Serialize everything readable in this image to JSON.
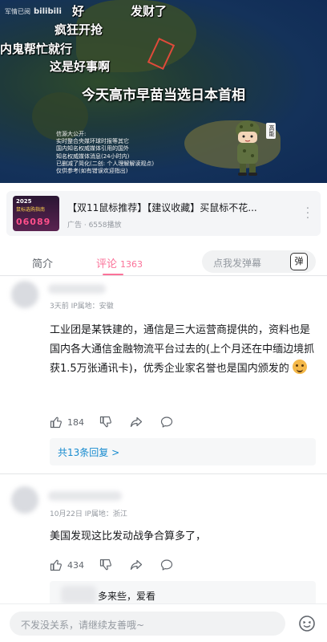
{
  "video": {
    "brand_left": "军情已阅",
    "brand_logo": "bilibili",
    "danmaku": [
      "好",
      "发财了",
      "疯狂开抢",
      "内鬼帮忙就行",
      "这是好事啊"
    ],
    "caption": "今天高市早苗当选日本首相",
    "source_lines": [
      "信源大公开:",
      "实时整合央媒环球时报等其它",
      "国内知名权威媒体引用的国外",
      "知名权威媒体消息(24小时内)",
      "已删减了简化(二创: 个人理解解读观点)",
      "仅供参考(如有错误欢迎指出)"
    ],
    "soldier_tag": "高能"
  },
  "ad": {
    "thumb_line1": "2025",
    "thumb_line2": "鼠标选购指南",
    "thumb_line3": "06089",
    "title": "【双11鼠标推荐】【建议收藏】买鼠标不花...",
    "meta": "广告 · 6558播放",
    "more_icon": "more-vertical-icon"
  },
  "tabs": {
    "intro": "简介",
    "comments": "评论",
    "comments_count": "1363",
    "danmaku_placeholder": "点我发弹幕",
    "danmaku_button": "弹"
  },
  "comments": [
    {
      "meta": "3天前 IP属地：安徽",
      "text": "工业团是某铁建的，通信是三大运营商提供的，资料也是国内各大通信金融物流平台过去的(上个月还在中缅边境抓获1.5万张通讯卡)，优秀企业家名誉也是国内颁发的",
      "likes": "184",
      "replies_label": "共13条回复 >"
    },
    {
      "meta": "10月22日 IP属地：浙江",
      "text": "美国发现这比发动战争合算多了，",
      "likes": "434",
      "sub_reply_text": "多来些，爱看"
    }
  ],
  "bottom": {
    "reply_placeholder": "不发没关系，请继续友善哦~",
    "emoji_icon": "smile-icon"
  },
  "colors": {
    "accent": "#fb7299",
    "link": "#178bcf",
    "muted": "#9499a0"
  }
}
